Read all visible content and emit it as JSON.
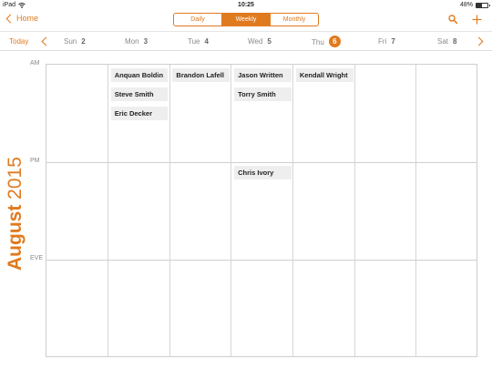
{
  "status_bar": {
    "device": "iPad",
    "time": "10:25",
    "battery": "48%",
    "battery_level": 0.48
  },
  "nav": {
    "back_label": "Home",
    "views": [
      {
        "label": "Daily",
        "active": false
      },
      {
        "label": "Weekly",
        "active": true
      },
      {
        "label": "Monthly",
        "active": false
      }
    ],
    "accent_color": "#e07a1f"
  },
  "day_strip": {
    "today_label": "Today",
    "days": [
      {
        "name": "Sun",
        "num": "2"
      },
      {
        "name": "Mon",
        "num": "3"
      },
      {
        "name": "Tue",
        "num": "4"
      },
      {
        "name": "Wed",
        "num": "5"
      },
      {
        "name": "Thu",
        "num": "6",
        "selected": true
      },
      {
        "name": "Fri",
        "num": "7"
      },
      {
        "name": "Sat",
        "num": "8"
      }
    ]
  },
  "month_label": {
    "month": "August",
    "year": "2015"
  },
  "periods": [
    "AM",
    "PM",
    "EVE"
  ],
  "events": [
    {
      "day": "Mon",
      "period": "AM",
      "title": "Anquan Boldin"
    },
    {
      "day": "Mon",
      "period": "AM",
      "title": "Steve Smith"
    },
    {
      "day": "Mon",
      "period": "AM",
      "title": "Eric Decker"
    },
    {
      "day": "Tue",
      "period": "AM",
      "title": "Brandon Lafell"
    },
    {
      "day": "Wed",
      "period": "AM",
      "title": "Jason Written"
    },
    {
      "day": "Wed",
      "period": "AM",
      "title": "Torry Smith"
    },
    {
      "day": "Wed",
      "period": "PM",
      "title": "Chris Ivory"
    },
    {
      "day": "Thu",
      "period": "AM",
      "title": "Kendall Wright"
    }
  ]
}
